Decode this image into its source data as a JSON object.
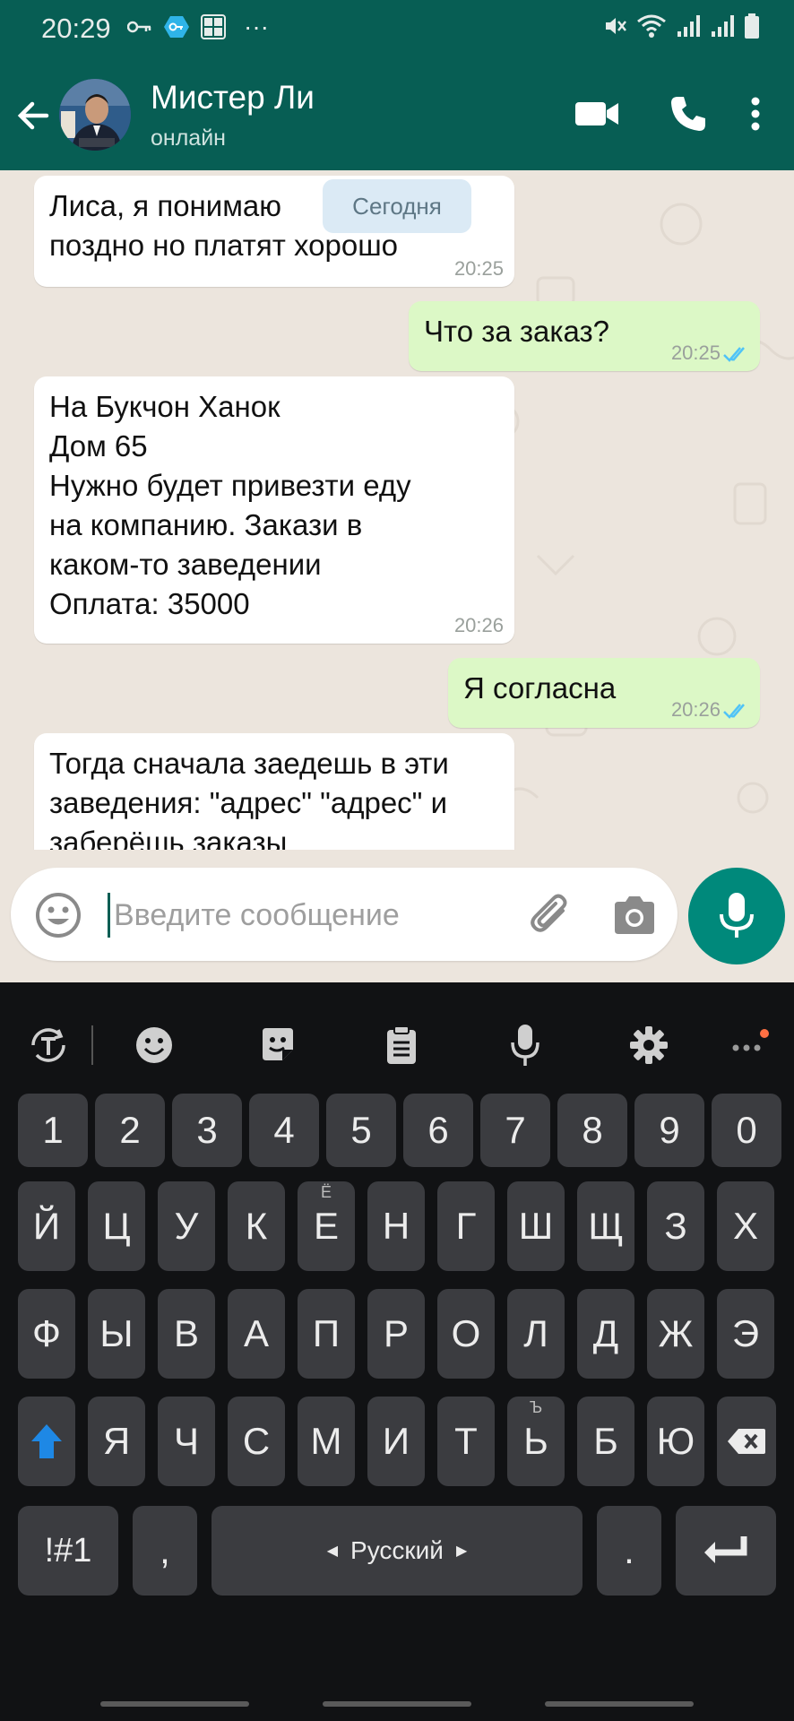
{
  "status_bar": {
    "time": "20:29",
    "more": "···"
  },
  "header": {
    "name": "Мистер Ли",
    "status": "онлайн"
  },
  "chat": {
    "date_chip": "Сегодня",
    "messages": [
      {
        "dir": "in",
        "lines": [
          "Лиса, я понимаю",
          "поздно но платят хорошо"
        ],
        "time": "20:25"
      },
      {
        "dir": "out",
        "lines": [
          "Что за заказ?"
        ],
        "time": "20:25",
        "read": true
      },
      {
        "dir": "in",
        "lines": [
          "На Букчон Ханок",
          "Дом 65",
          "Нужно будет привезти еду",
          "на компанию. Закази в",
          "каком-то заведении",
          "Оплата: 35000"
        ],
        "time": "20:26"
      },
      {
        "dir": "out",
        "lines": [
          "Я согласна"
        ],
        "time": "20:26",
        "read": true
      },
      {
        "dir": "in",
        "lines": [
          "Тогда сначала заедешь в эти",
          "заведения: \"адрес\" \"адрес\" и",
          "заберёшь заказы"
        ],
        "time": ""
      }
    ]
  },
  "composer": {
    "placeholder": "Введите сообщение"
  },
  "keyboard": {
    "numbers": [
      "1",
      "2",
      "3",
      "4",
      "5",
      "6",
      "7",
      "8",
      "9",
      "0"
    ],
    "row1": [
      "Й",
      "Ц",
      "У",
      "К",
      "Е",
      "Н",
      "Г",
      "Ш",
      "Щ",
      "З",
      "Х"
    ],
    "row1_sub": {
      "4": "Ё"
    },
    "row2": [
      "Ф",
      "Ы",
      "В",
      "А",
      "П",
      "Р",
      "О",
      "Л",
      "Д",
      "Ж",
      "Э"
    ],
    "row3": [
      "Я",
      "Ч",
      "С",
      "М",
      "И",
      "Т",
      "Ь",
      "Б",
      "Ю"
    ],
    "row3_sub": {
      "6": "Ъ"
    },
    "symbols_label": "!#1",
    "comma": ",",
    "space_label": "Русский",
    "period": ".",
    "accent_color": "#1e88e5"
  },
  "colors": {
    "header": "#075e54",
    "fab": "#00897b",
    "out_bubble": "#dcf8c6",
    "tick_blue": "#4fc3f7"
  }
}
